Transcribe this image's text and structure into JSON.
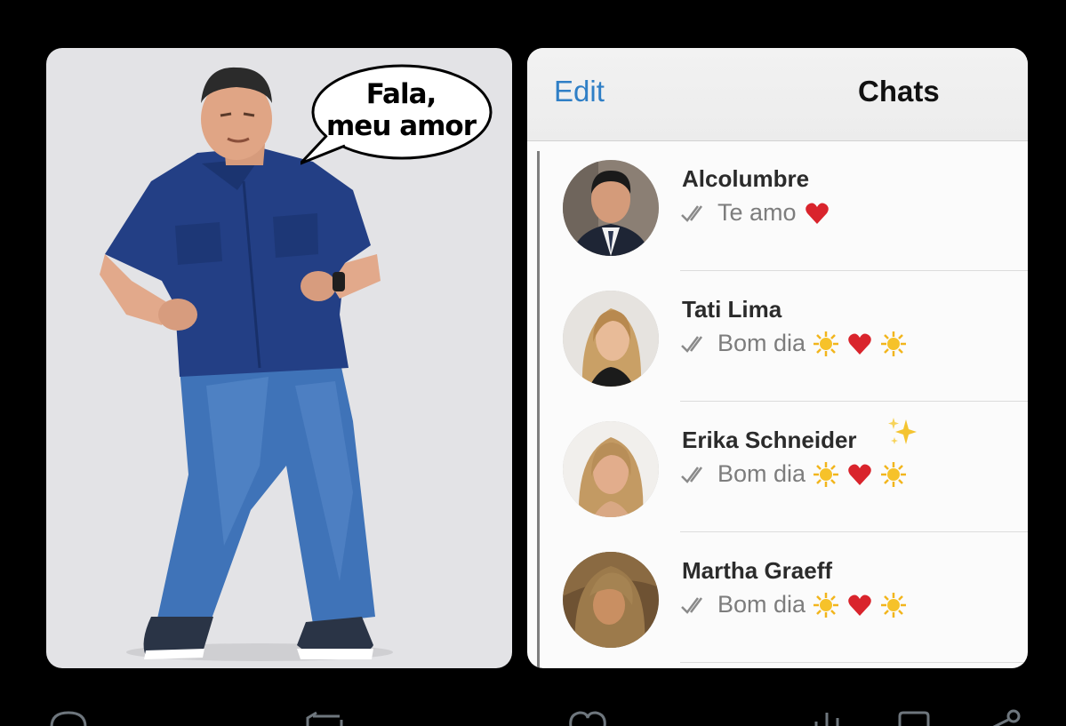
{
  "meme": {
    "speech_line1": "Fala,",
    "speech_line2": "meu amor"
  },
  "chat_app": {
    "edit_label": "Edit",
    "title": "Chats",
    "accent_color": "#2f7fc6",
    "chats": [
      {
        "name": "Alcolumbre",
        "preview": "Te amo",
        "emojis": [
          "red-heart"
        ]
      },
      {
        "name": "Tati Lima",
        "preview": "Bom dia",
        "emojis": [
          "sun",
          "red-heart",
          "sun"
        ]
      },
      {
        "name": "Erika Schneider",
        "preview": "Bom dia",
        "emojis": [
          "sun",
          "red-heart",
          "sun"
        ],
        "name_emoji": "sparkles"
      },
      {
        "name": "Martha Graeff",
        "preview": "Bom dia",
        "emojis": [
          "sun",
          "red-heart",
          "sun"
        ]
      }
    ]
  },
  "action_bar": {
    "icons": [
      "reply-icon",
      "retweet-icon",
      "like-icon",
      "stats-icon",
      "bookmark-icon",
      "share-icon"
    ]
  }
}
